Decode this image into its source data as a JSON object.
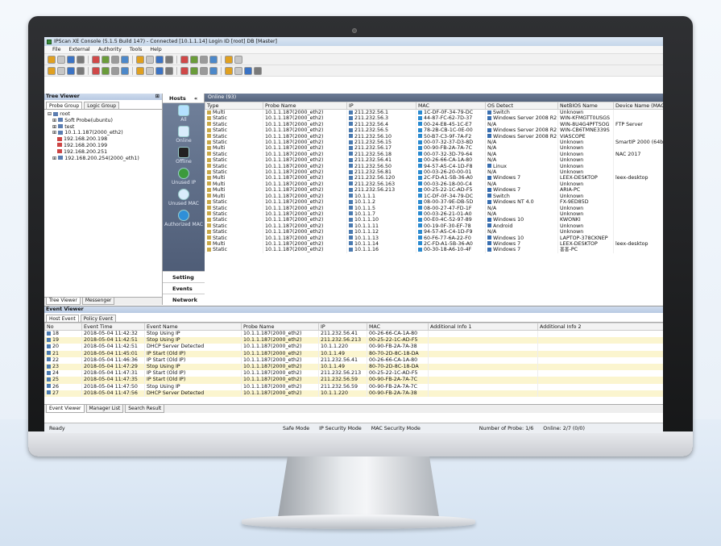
{
  "window_title": "IPScan XE Console (5.1.5  Build 147) - Connected [10.1.1.14]  Login ID [root]  DB [Master]",
  "menu": [
    "File",
    "External",
    "Authority",
    "Tools",
    "Help"
  ],
  "tree_viewer": {
    "title": "Tree Viewer",
    "pin": "⊞",
    "tabs": [
      "Probe Group",
      "Logic Group"
    ],
    "items": [
      "root",
      "Soft Probe(ubuntu)",
      "test",
      "10.1.1.187(2000_eth2)",
      "192.168.200.198",
      "192.168.200.199",
      "192.168.200.251",
      "192.168.200.254(2000_eth1)"
    ],
    "bottom_tabs": [
      "Tree Viewer",
      "Messenger"
    ]
  },
  "hosts": {
    "title": "Hosts",
    "chevron": "«",
    "buttons": [
      "All",
      "Online",
      "Offline",
      "Unused IP",
      "Unused MAC",
      "Authorized MAC"
    ],
    "footer": [
      "Setting",
      "Events",
      "Network"
    ]
  },
  "grid": {
    "title": "Online (93)",
    "columns": [
      "Type",
      "Probe Name",
      "IP",
      "MAC",
      "OS Detect",
      "NetBIOS Name",
      "Device Name (MAC"
    ],
    "rows": [
      [
        "Multi",
        "10.1.1.187(2000_eth2)",
        "211.232.56.1",
        "1C-DF-0F-34-79-DC",
        "Switch",
        "Unknown",
        ""
      ],
      [
        "Static",
        "10.1.1.187(2000_eth2)",
        "211.232.56.3",
        "44-87-FC-62-7D-37",
        "Windows Server 2008 R2",
        "WIN-KFMGTT0USGS",
        ""
      ],
      [
        "Static",
        "10.1.1.187(2000_eth2)",
        "211.232.56.4",
        "00-24-E8-45-1C-E7",
        "N/A",
        "WIN-8U4G4PFTSOG",
        "FTP Server"
      ],
      [
        "Static",
        "10.1.1.187(2000_eth2)",
        "211.232.56.5",
        "78-2B-CB-1C-0E-00",
        "Windows Server 2008 R2",
        "WIN-CB6TMNE339S",
        ""
      ],
      [
        "Static",
        "10.1.1.187(2000_eth2)",
        "211.232.56.10",
        "50-B7-C3-9F-7A-F2",
        "Windows Server 2008 R2",
        "VIASCOPE",
        ""
      ],
      [
        "Static",
        "10.1.1.187(2000_eth2)",
        "211.232.56.15",
        "00-07-32-37-D3-8D",
        "N/A",
        "Unknown",
        "SmartIP 2000 (64bi"
      ],
      [
        "Multi",
        "10.1.1.187(2000_eth2)",
        "211.232.56.17",
        "00-90-FB-2A-7A-7C",
        "N/A",
        "Unknown",
        ""
      ],
      [
        "Static",
        "10.1.1.187(2000_eth2)",
        "211.232.56.18",
        "00-07-32-3D-79-64",
        "N/A",
        "Unknown",
        "NAC 2017"
      ],
      [
        "Static",
        "10.1.1.187(2000_eth2)",
        "211.232.56.41",
        "00-26-66-CA-1A-80",
        "N/A",
        "Unknown",
        ""
      ],
      [
        "Static",
        "10.1.1.187(2000_eth2)",
        "211.232.56.50",
        "94-57-A5-C4-1D-F8",
        "Linux",
        "Unknown",
        ""
      ],
      [
        "Static",
        "10.1.1.187(2000_eth2)",
        "211.232.56.81",
        "00-03-26-20-00-01",
        "N/A",
        "Unknown",
        ""
      ],
      [
        "Multi",
        "10.1.1.187(2000_eth2)",
        "211.232.56.120",
        "2C-FD-A1-5B-36-A0",
        "Windows 7",
        "LEEX-DESKTOP",
        "leex-desktop"
      ],
      [
        "Multi",
        "10.1.1.187(2000_eth2)",
        "211.232.56.163",
        "00-03-26-18-00-C4",
        "N/A",
        "Unknown",
        ""
      ],
      [
        "Multi",
        "10.1.1.187(2000_eth2)",
        "211.232.56.213",
        "00-25-22-1C-AD-F5",
        "Windows 7",
        "ARIA-PC",
        ""
      ],
      [
        "Multi",
        "10.1.1.187(2000_eth2)",
        "10.1.1.1",
        "1C-DF-0F-34-79-DC",
        "Switch",
        "Unknown",
        ""
      ],
      [
        "Static",
        "10.1.1.187(2000_eth2)",
        "10.1.1.2",
        "08-00-37-9E-DB-5D",
        "Windows NT 4.0",
        "FX-9ED85D",
        ""
      ],
      [
        "Static",
        "10.1.1.187(2000_eth2)",
        "10.1.1.5",
        "08-00-27-47-FD-1F",
        "N/A",
        "Unknown",
        ""
      ],
      [
        "Static",
        "10.1.1.187(2000_eth2)",
        "10.1.1.7",
        "00-03-26-21-01-A0",
        "N/A",
        "Unknown",
        ""
      ],
      [
        "Static",
        "10.1.1.187(2000_eth2)",
        "10.1.1.10",
        "00-E0-4C-52-97-89",
        "Windows 10",
        "KWONKI",
        ""
      ],
      [
        "Static",
        "10.1.1.187(2000_eth2)",
        "10.1.1.11",
        "00-19-0F-30-EF-78",
        "Android",
        "Unknown",
        ""
      ],
      [
        "Static",
        "10.1.1.187(2000_eth2)",
        "10.1.1.12",
        "94-57-A5-C4-1D-F9",
        "N/A",
        "Unknown",
        ""
      ],
      [
        "Static",
        "10.1.1.187(2000_eth2)",
        "10.1.1.13",
        "60-F6-77-6A-22-F0",
        "Windows 10",
        "LAPTOP-378CKNEP",
        ""
      ],
      [
        "Multi",
        "10.1.1.187(2000_eth2)",
        "10.1.1.14",
        "2C-FD-A1-5B-36-A0",
        "Windows 7",
        "LEEX-DESKTOP",
        "leex-desktop"
      ],
      [
        "Static",
        "10.1.1.187(2000_eth2)",
        "10.1.1.16",
        "00-30-18-A6-10-4F",
        "Windows 7",
        "홍홍-PC",
        ""
      ]
    ]
  },
  "event_viewer": {
    "title": "Event Viewer",
    "tabs": [
      "Host Event",
      "Policy Event"
    ],
    "columns": [
      "No",
      "Event Time",
      "Event Name",
      "Probe Name",
      "IP",
      "MAC",
      "Additional Info 1",
      "Additional Info 2"
    ],
    "rows": [
      [
        "18",
        "2018-05-04  11:42:32",
        "Stop Using IP",
        "10.1.1.187(2000_eth2)",
        "211.232.56.41",
        "00-26-66-CA-1A-80",
        "",
        ""
      ],
      [
        "19",
        "2018-05-04  11:42:51",
        "Stop Using IP",
        "10.1.1.187(2000_eth2)",
        "211.232.56.213",
        "00-25-22-1C-AD-F5",
        "",
        ""
      ],
      [
        "20",
        "2018-05-04  11:42:51",
        "DHCP Server Detected",
        "10.1.1.187(2000_eth2)",
        "10.1.1.220",
        "00-90-FB-2A-7A-38",
        "",
        ""
      ],
      [
        "21",
        "2018-05-04  11:45:01",
        "IP Start (Old IP)",
        "10.1.1.187(2000_eth2)",
        "10.1.1.49",
        "80-70-2D-8C-18-DA",
        "",
        ""
      ],
      [
        "22",
        "2018-05-04  11:46:36",
        "IP Start (Old IP)",
        "10.1.1.187(2000_eth2)",
        "211.232.56.41",
        "00-26-66-CA-1A-80",
        "",
        ""
      ],
      [
        "23",
        "2018-05-04  11:47:29",
        "Stop Using IP",
        "10.1.1.187(2000_eth2)",
        "10.1.1.49",
        "80-70-2D-8C-18-DA",
        "",
        ""
      ],
      [
        "24",
        "2018-05-04  11:47:31",
        "IP Start (Old IP)",
        "10.1.1.187(2000_eth2)",
        "211.232.56.213",
        "00-25-22-1C-AD-F5",
        "",
        ""
      ],
      [
        "25",
        "2018-05-04  11:47:35",
        "IP Start (Old IP)",
        "10.1.1.187(2000_eth2)",
        "211.232.56.59",
        "00-90-FB-2A-7A-7C",
        "",
        ""
      ],
      [
        "26",
        "2018-05-04  11:47:50",
        "Stop Using IP",
        "10.1.1.187(2000_eth2)",
        "211.232.56.59",
        "00-90-FB-2A-7A-7C",
        "",
        ""
      ],
      [
        "27",
        "2018-05-04  11:47:56",
        "DHCP Server Detected",
        "10.1.1.187(2000_eth2)",
        "10.1.1.220",
        "00-90-FB-2A-7A-38",
        "",
        ""
      ]
    ],
    "bottom_tabs": [
      "Event Viewer",
      "Manager List",
      "Search Result"
    ]
  },
  "status": {
    "ready": "Ready",
    "safe_mode": "Safe Mode",
    "ip_security": "IP Security Mode",
    "mac_security": "MAC Security Mode",
    "probes": "Number of Probe: 1/6",
    "online": "Online: 2/7 (0/0)"
  },
  "colors": {
    "accent": "#55637c",
    "event_highlight": "#fbf5cf",
    "title_bar": "#c5d6ea"
  }
}
